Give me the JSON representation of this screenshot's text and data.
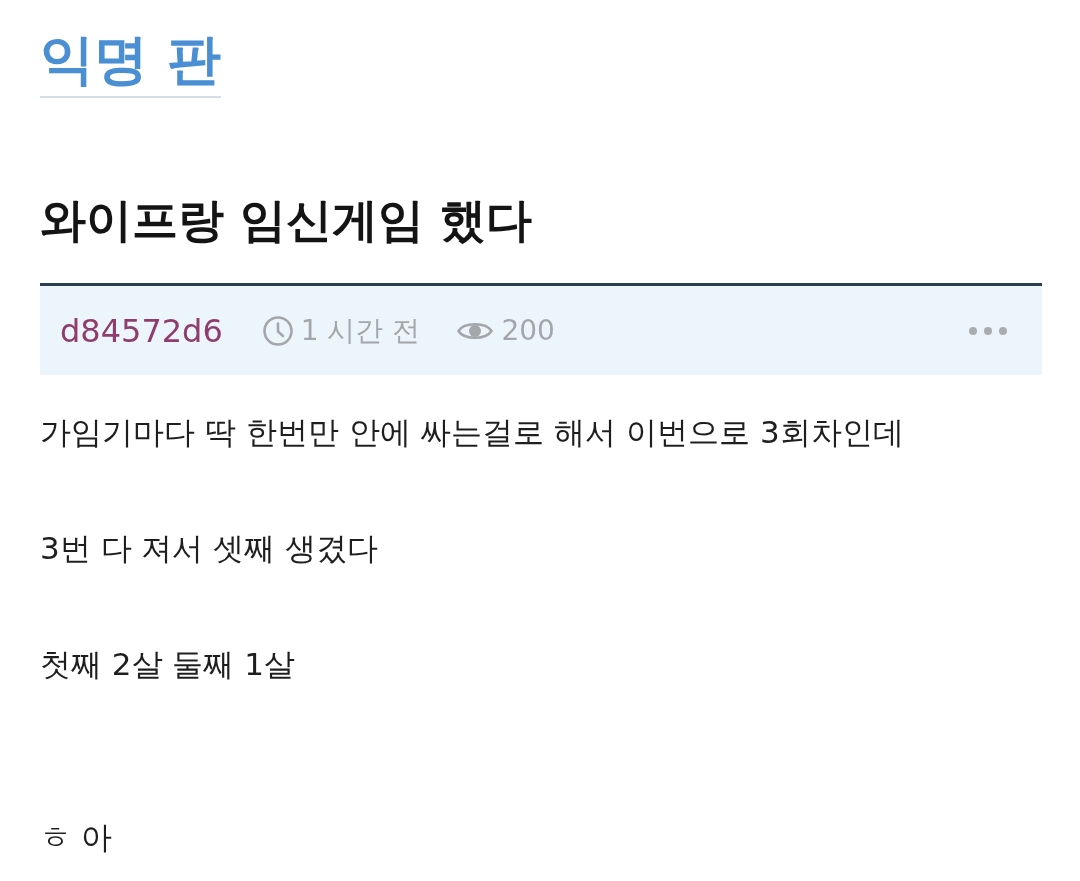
{
  "board": {
    "title": "익명 판"
  },
  "post": {
    "title": "와이프랑 임신게임 했다",
    "meta": {
      "author": "d84572d6",
      "time": "1 시간 전",
      "views": "200"
    },
    "body": [
      {
        "text": "가임기마다 딱 한번만 안에 싸는걸로 해서 이번으로 3회차인데",
        "kind": "lead"
      },
      {
        "text": "3번 다 져서 셋째 생겼다",
        "kind": "para"
      },
      {
        "text": "첫째 2살 둘째 1살",
        "kind": "para"
      },
      {
        "text": "ㅎ 아",
        "kind": "spaced"
      }
    ]
  }
}
